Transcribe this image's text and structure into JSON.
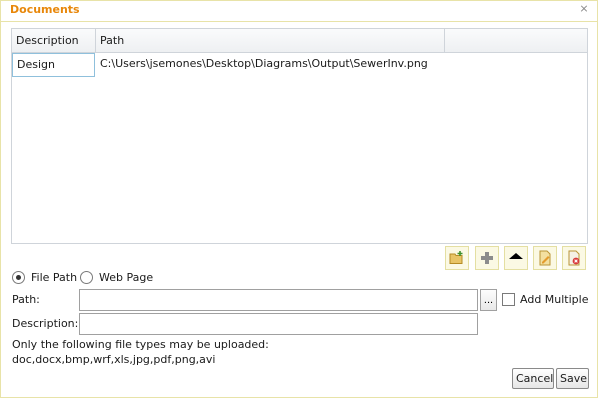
{
  "dialog": {
    "title": "Documents",
    "close_glyph": "⨯",
    "close_icon": "close-icon"
  },
  "grid": {
    "columns": [
      "Description",
      "Path"
    ],
    "rows": [
      {
        "description": "Design",
        "path": "C:\\Users\\jsemones\\Desktop\\Diagrams\\Output\\SewerInv.png"
      }
    ]
  },
  "toolbar": {
    "icons": [
      "add-folder-icon",
      "plus-icon",
      "move-up-icon",
      "edit-document-icon",
      "delete-document-icon"
    ]
  },
  "source": {
    "file_path_label": "File Path",
    "web_page_label": "Web Page",
    "selected": "File Path"
  },
  "form": {
    "path_label": "Path:",
    "path_value": "",
    "browse_label": "...",
    "add_multiple_label": "Add Multiple",
    "add_multiple_checked": false,
    "description_label": "Description:",
    "description_value": ""
  },
  "note": {
    "line1": "Only the following file types may be uploaded:",
    "line2": "doc,docx,bmp,wrf,xls,jpg,pdf,png,avi"
  },
  "buttons": {
    "cancel": "Cancel",
    "save": "Save"
  },
  "colors": {
    "title": "#e8870a",
    "dialog_border": "#e8e3a8",
    "toolbar_bg": "#fbf9e4",
    "selected_cell_border": "#8fc0dc"
  }
}
